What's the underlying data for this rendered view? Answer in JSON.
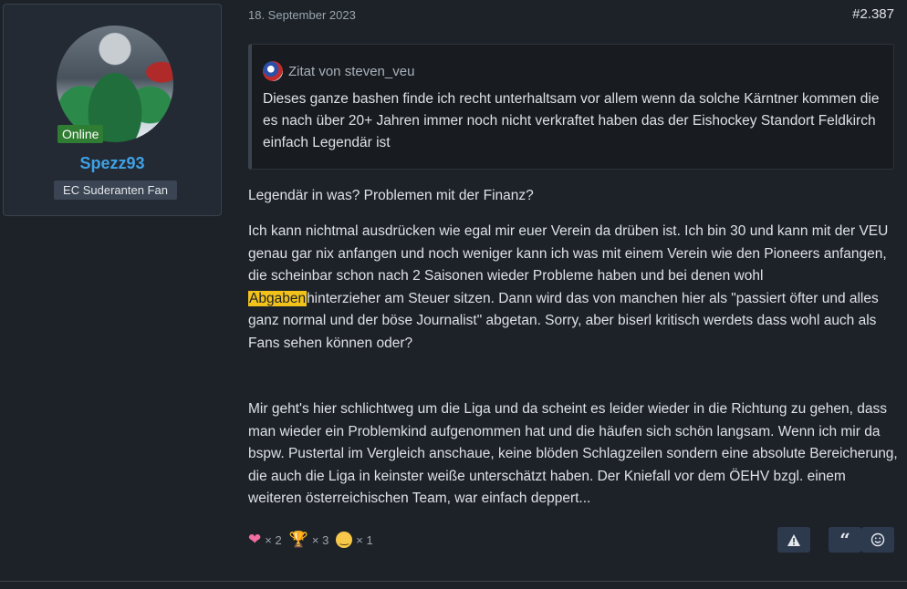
{
  "user": {
    "online_label": "Online",
    "username": "Spezz93",
    "title": "EC Suderanten Fan"
  },
  "post": {
    "date": "18. September 2023",
    "number": "#2.387",
    "quote": {
      "author_line": "Zitat von steven_veu",
      "text": "Dieses ganze bashen finde ich recht unterhaltsam vor allem wenn da solche Kärntner kommen die es nach über 20+ Jahren immer noch nicht verkraftet haben das der Eishockey Standort Feldkirch einfach Legendär ist"
    },
    "para1": "Legendär in was? Problemen mit der Finanz?",
    "para2_before": "Ich kann nichtmal ausdrücken wie egal mir euer Verein da drüben ist. Ich bin 30 und kann mit der VEU genau gar nix anfangen und noch weniger kann ich was mit einem Verein wie den Pioneers anfangen, die scheinbar schon nach 2 Saisonen wieder Probleme haben und bei denen wohl ",
    "para2_highlight": "Abgaben",
    "para2_after": "hinterzieher am Steuer sitzen. Dann wird das von manchen hier als \"passiert öfter und alles ganz normal und der böse Journalist\" abgetan. Sorry, aber biserl kritisch werdets dass wohl auch als Fans sehen können oder?",
    "para3": "Mir geht's hier schlichtweg um die Liga und da scheint es leider wieder in die Richtung zu gehen, dass man wieder ein Problemkind aufgenommen hat und die häufen sich schön langsam. Wenn ich mir da bspw. Pustertal im Vergleich anschaue, keine blöden Schlagzeilen sondern eine absolute Bereicherung, die auch die Liga in keinster weiße unterschätzt haben. Der Kniefall vor dem ÖEHV bzgl. einem weiteren österreichischen Team, war einfach deppert..."
  },
  "reactions": [
    {
      "icon": "heart-icon",
      "count": "× 2"
    },
    {
      "icon": "trophy-icon",
      "count": "× 3"
    },
    {
      "icon": "grin-icon",
      "count": "× 1"
    }
  ],
  "colors": {
    "background": "#1d2228",
    "username": "#3fa1e6",
    "online": "#2f7d32",
    "highlight": "#f2c21b",
    "button": "#2d3a4e"
  }
}
